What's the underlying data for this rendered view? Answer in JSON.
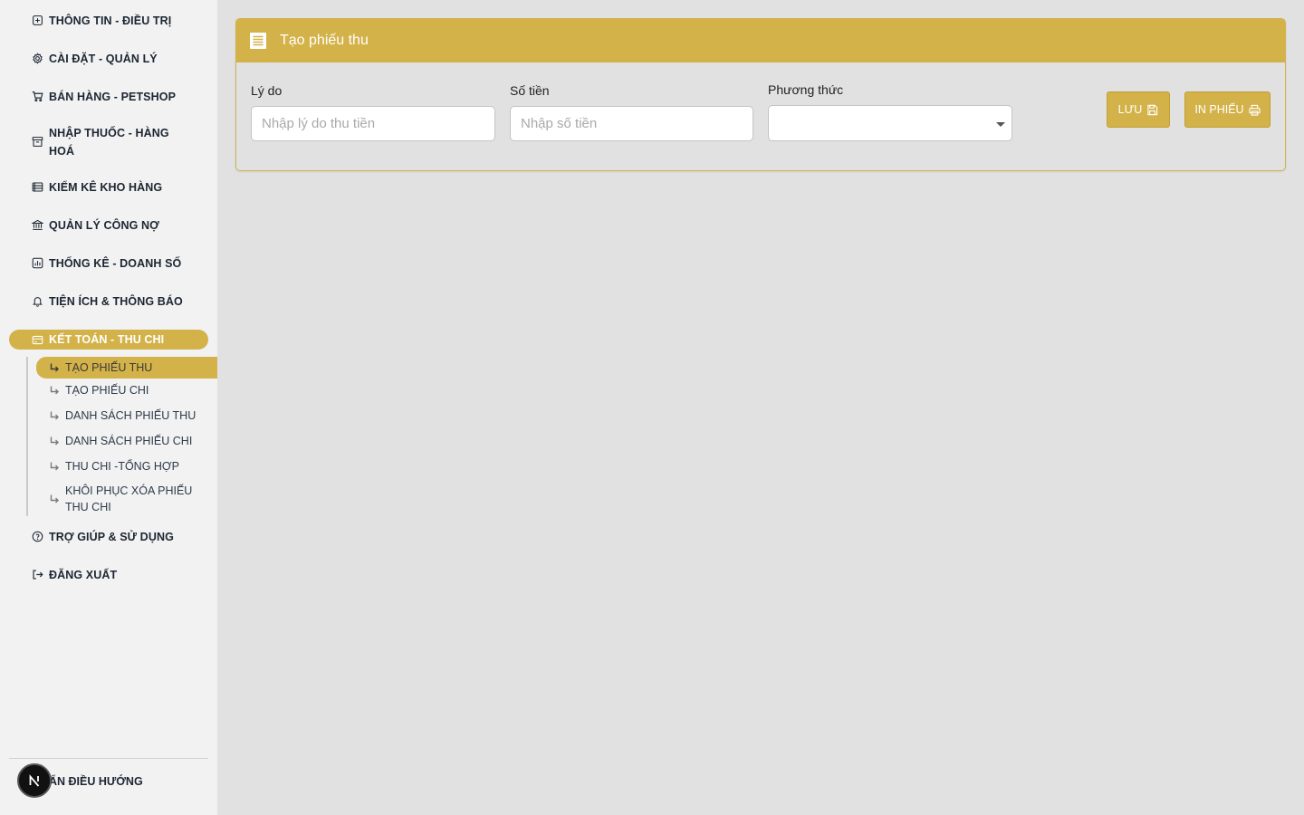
{
  "sidebar": {
    "items": [
      {
        "label": "THÔNG TIN - ĐIỀU TRỊ",
        "icon": "medical-cross-icon"
      },
      {
        "label": "CÀI ĐẶT - QUẢN LÝ",
        "icon": "gear-icon"
      },
      {
        "label": "BÁN HÀNG - PETSHOP",
        "icon": "cart-icon"
      },
      {
        "label": "NHẬP THUỐC - HÀNG HOÁ",
        "icon": "archive-icon"
      },
      {
        "label": "KIỂM KÊ KHO HÀNG",
        "icon": "list-icon"
      },
      {
        "label": "QUẢN LÝ CÔNG NỢ",
        "icon": "bank-icon"
      },
      {
        "label": "THỐNG KÊ - DOANH SỐ",
        "icon": "bar-chart-icon"
      },
      {
        "label": "TIỆN ÍCH & THÔNG BÁO",
        "icon": "bell-icon"
      },
      {
        "label": "KẾT TOÁN - THU CHI",
        "icon": "credit-card-icon",
        "active": true
      },
      {
        "label": "TRỢ GIÚP & SỬ DỤNG",
        "icon": "help-icon"
      },
      {
        "label": "ĐĂNG XUẤT",
        "icon": "logout-icon"
      }
    ],
    "subitems": [
      {
        "label": "TẠO PHIẾU THU",
        "active": true
      },
      {
        "label": "TẠO PHIẾU CHI"
      },
      {
        "label": "DANH SÁCH PHIẾU THU"
      },
      {
        "label": "DANH SÁCH PHIẾU CHI"
      },
      {
        "label": "THU CHI -TỔNG HỢP"
      },
      {
        "label": "KHÔI PHỤC XÓA PHIẾU THU CHI"
      }
    ],
    "hide_nav_label": "ẨN ĐIỀU HƯỚNG"
  },
  "form": {
    "title": "Tạo phiếu thu",
    "reason_label": "Lý do",
    "reason_placeholder": "Nhập lý do thu tiền",
    "amount_label": "Số tiền",
    "amount_placeholder": "Nhập số tiền",
    "method_label": "Phương thức",
    "method_value": "",
    "save_label": "LƯU",
    "print_label": "IN PHIẾU"
  },
  "colors": {
    "accent": "#d4b24a",
    "sidebar_bg": "#f2f2f2",
    "main_bg": "#e1e1e1"
  }
}
